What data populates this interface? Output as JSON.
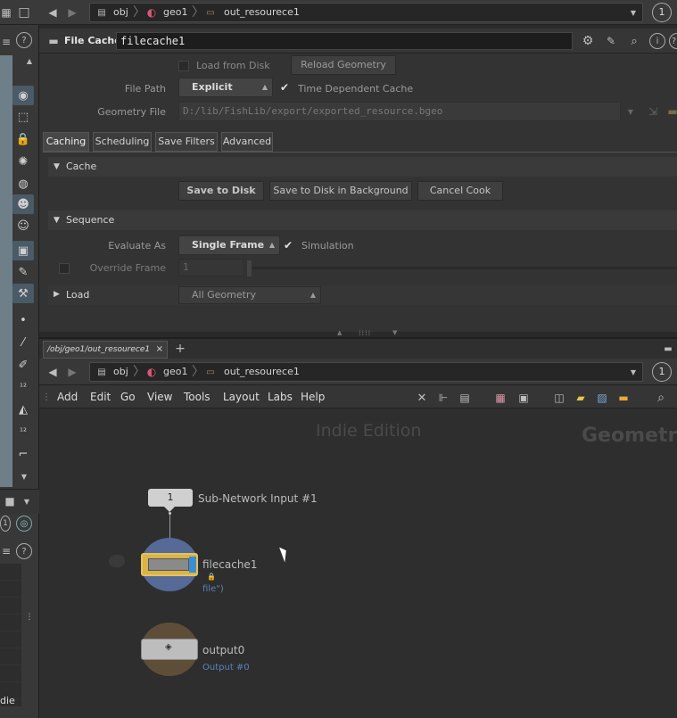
{
  "top_path": {
    "crumbs": [
      "obj",
      "geo1",
      "out_resourece1"
    ],
    "pin_label": "1"
  },
  "param_header": {
    "node_type": "File Cache",
    "node_name": "filecache1"
  },
  "params": {
    "load_from_disk": "Load from Disk",
    "reload_geometry": "Reload Geometry",
    "file_path_label": "File Path",
    "file_path_mode": "Explicit",
    "time_dependent": "Time Dependent Cache",
    "geometry_file_label": "Geometry File",
    "geometry_file": "D:/lib/FishLib/export/exported_resource.bgeo",
    "tabs": [
      "Caching",
      "Scheduling",
      "Save Filters",
      "Advanced"
    ],
    "cache_folder": "Cache",
    "save_to_disk": "Save to Disk",
    "save_in_bg": "Save to Disk in Background",
    "cancel_cook": "Cancel Cook",
    "sequence_folder": "Sequence",
    "evaluate_as_label": "Evaluate As",
    "evaluate_as": "Single Frame",
    "simulation": "Simulation",
    "override_frame_label": "Override Frame",
    "override_frame_value": "1",
    "load_folder": "Load",
    "load_mode": "All Geometry"
  },
  "network": {
    "tab_label": "/obj/geo1/out_resourece1",
    "crumbs": [
      "obj",
      "geo1",
      "out_resourece1"
    ],
    "pin_label": "1",
    "menu": [
      "Add",
      "Edit",
      "Go",
      "View",
      "Tools",
      "Layout",
      "Labs",
      "Help"
    ],
    "watermark": "Indie Edition",
    "context_label": "Geometry",
    "subnet_input_index": "1",
    "subnet_input_label": "Sub-Network Input #1",
    "node1_name": "filecache1",
    "node1_sub": "file\")",
    "node2_name": "output0",
    "node2_sub": "Output #0"
  },
  "left_strip": {
    "bottom_label": "die"
  }
}
